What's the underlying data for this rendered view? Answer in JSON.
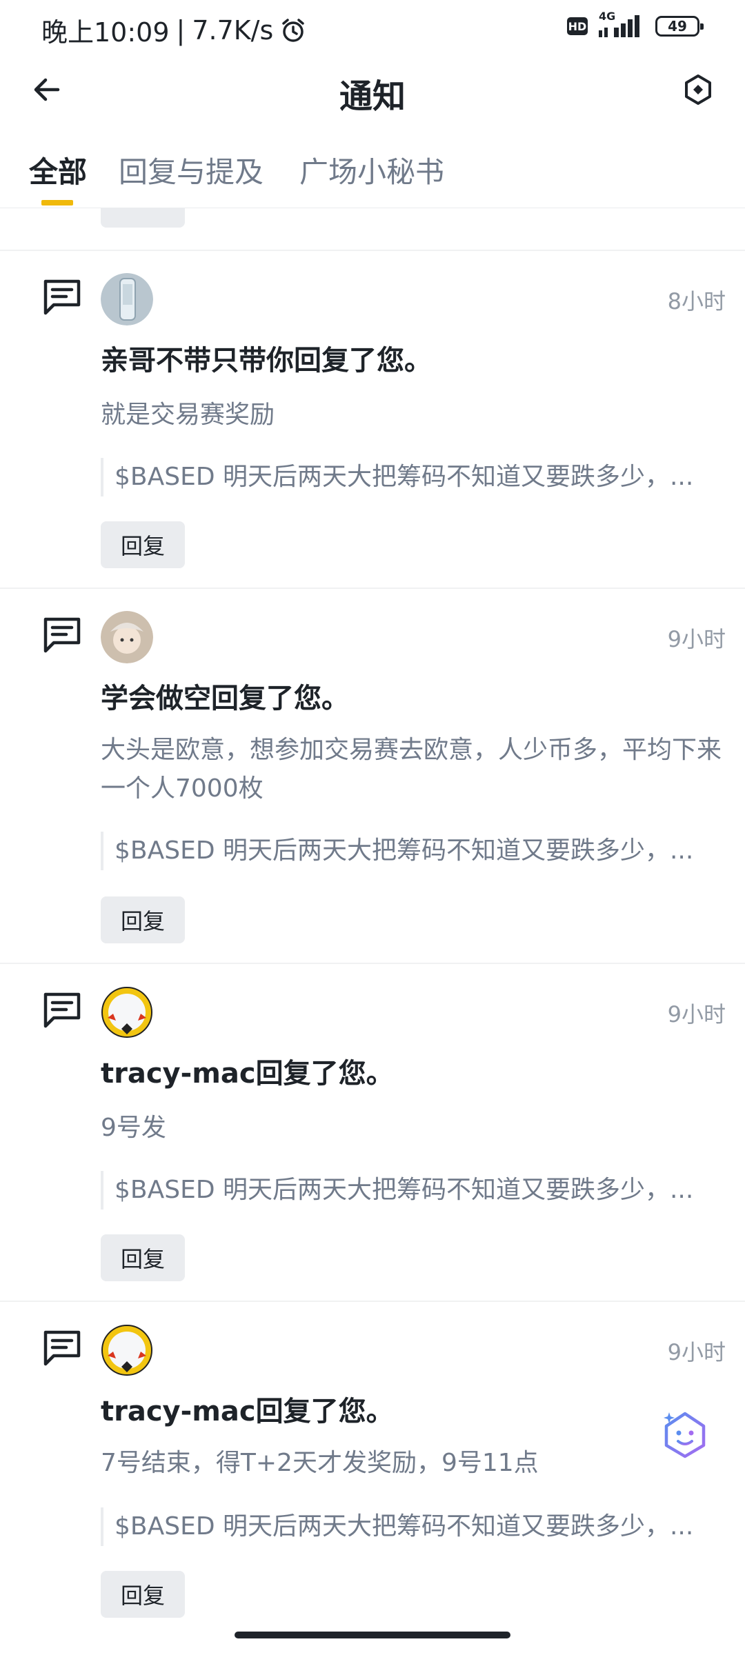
{
  "status_bar": {
    "time": "晚上10:09",
    "speed": "7.7K/s",
    "hd": "HD",
    "network": "4G",
    "battery": "49"
  },
  "header": {
    "title": "通知"
  },
  "tabs": [
    {
      "label": "全部",
      "active": true
    },
    {
      "label": "回复与提及",
      "active": false
    },
    {
      "label": "广场小秘书",
      "active": false
    }
  ],
  "notifications": [
    {
      "time": "8小时",
      "title": "亲哥不带只带你回复了您。",
      "body": "就是交易赛奖励",
      "quote": "$BASED 明天后两天大把筹码不知道又要跌多少，...",
      "reply_label": "回复"
    },
    {
      "time": "9小时",
      "title": "学会做空回复了您。",
      "body": "大头是欧意，想参加交易赛去欧意，人少币多，平均下来一个人7000枚",
      "quote": "$BASED 明天后两天大把筹码不知道又要跌多少，...",
      "reply_label": "回复"
    },
    {
      "time": "9小时",
      "title": "tracy-mac回复了您。",
      "body": "9号发",
      "quote": "$BASED 明天后两天大把筹码不知道又要跌多少，...",
      "reply_label": "回复"
    },
    {
      "time": "9小时",
      "title": "tracy-mac回复了您。",
      "body": "7号结束，得T+2天才发奖励，9号11点",
      "quote": "$BASED 明天后两天大把筹码不知道又要跌多少，...",
      "reply_label": "回复"
    }
  ],
  "colors": {
    "accent": "#f0b90b",
    "text": "#1e2329",
    "muted": "#707a8a",
    "button_bg": "#eaecef"
  }
}
